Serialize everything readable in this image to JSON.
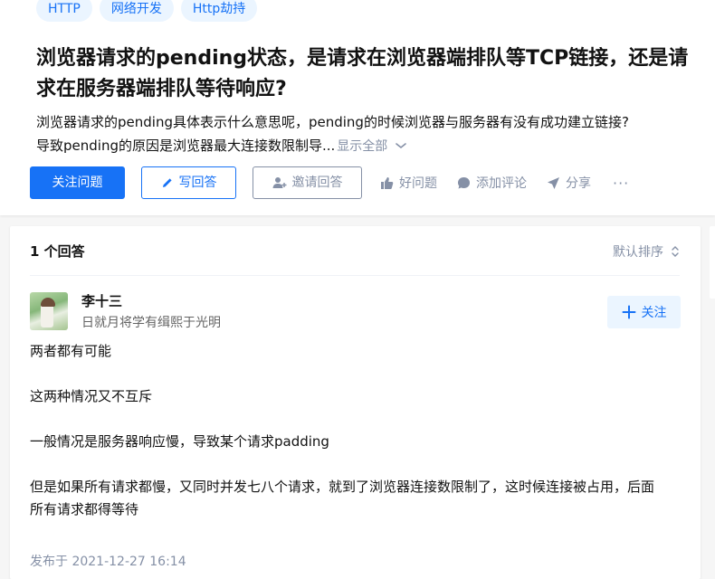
{
  "question": {
    "tags": [
      "HTTP",
      "网络开发",
      "Http劫持"
    ],
    "title": "浏览器请求的pending状态，是请求在浏览器端排队等TCP链接，还是请求在服务器端排队等待响应?",
    "description_line1": "浏览器请求的pending具体表示什么意思呢，pending的时候浏览器与服务器有没有成功建立链接?",
    "description_line2": "导致pending的原因是浏览器最大连接数限制导...",
    "show_all": "显示全部"
  },
  "actions": {
    "follow": "关注问题",
    "write": "写回答",
    "invite": "邀请回答",
    "good_question": "好问题",
    "add_comment": "添加评论",
    "share": "分享",
    "more": "···"
  },
  "answers": {
    "count_label": "1 个回答",
    "sort_label": "默认排序",
    "author": {
      "name": "李十三",
      "bio": "日就月将学有缉熙于光明",
      "follow_label": "关注"
    },
    "paragraphs": [
      "两者都有可能",
      "这两种情况又不互斥",
      "一般情况是服务器响应慢，导致某个请求padding",
      "但是如果所有请求都慢，又同时并发七八个请求，就到了浏览器连接数限制了，这时候连接被占用，后面所有请求都得等待"
    ],
    "published": "发布于 2021-12-27 16:14"
  },
  "colors": {
    "brand_blue": "#1772f6",
    "light_blue": "#ebf5ff",
    "gray_text": "#8590a6",
    "page_bg": "#f6f6f6"
  }
}
